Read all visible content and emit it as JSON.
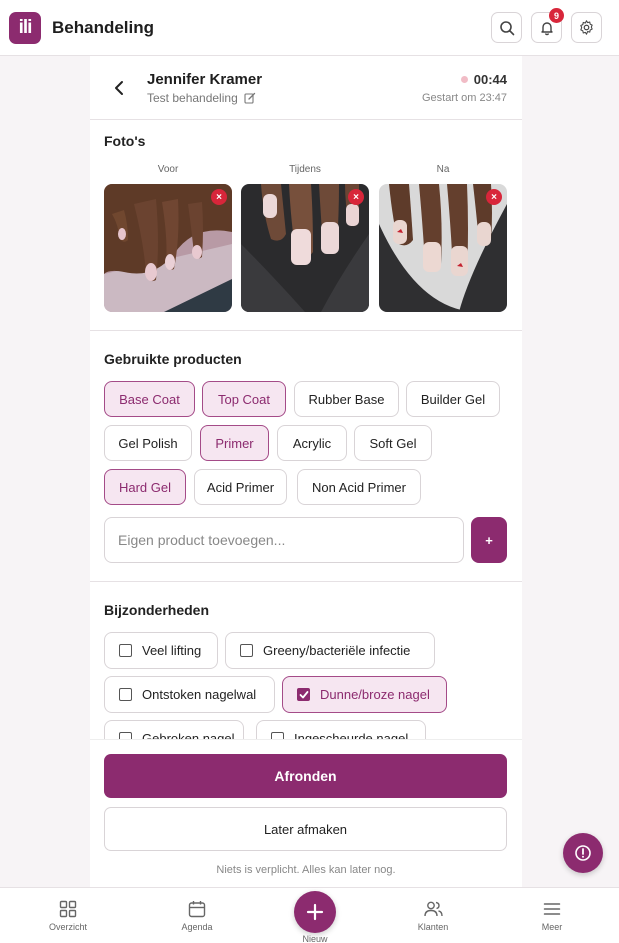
{
  "app": {
    "logo_text": "ili",
    "title": "Behandeling",
    "notification_count": "9",
    "accent": "#8c2b6f"
  },
  "header": {
    "client_name": "Jennifer Kramer",
    "treatment_name": "Test behandeling",
    "timer": "00:44",
    "started": "Gestart om 23:47"
  },
  "photos": {
    "title": "Foto's",
    "items": [
      {
        "label": "Voor"
      },
      {
        "label": "Tijdens"
      },
      {
        "label": "Na"
      }
    ],
    "remove_label": "×"
  },
  "products": {
    "title": "Gebruikte producten",
    "chips": [
      {
        "label": "Base Coat",
        "selected": true
      },
      {
        "label": "Top Coat",
        "selected": true
      },
      {
        "label": "Rubber Base",
        "selected": false
      },
      {
        "label": "Builder Gel",
        "selected": false
      },
      {
        "label": "Gel Polish",
        "selected": false
      },
      {
        "label": "Primer",
        "selected": true
      },
      {
        "label": "Acrylic",
        "selected": false
      },
      {
        "label": "Soft Gel",
        "selected": false
      },
      {
        "label": "Hard Gel",
        "selected": true
      },
      {
        "label": "Acid Primer",
        "selected": false
      },
      {
        "label": "Non Acid Primer",
        "selected": false
      }
    ],
    "custom_placeholder": "Eigen product toevoegen...",
    "add_label": "+"
  },
  "details": {
    "title": "Bijzonderheden",
    "items": [
      {
        "label": "Veel lifting",
        "checked": false
      },
      {
        "label": "Greeny/bacteriële infectie",
        "checked": false
      },
      {
        "label": "Ontstoken nagelwal",
        "checked": false
      },
      {
        "label": "Dunne/broze nagel",
        "checked": true
      },
      {
        "label": "Gebroken nagel",
        "checked": false
      },
      {
        "label": "Ingescheurde nagel",
        "checked": false
      }
    ]
  },
  "footer": {
    "finish": "Afronden",
    "later": "Later afmaken",
    "hint": "Niets is verplicht. Alles kan later nog."
  },
  "nav": {
    "items": [
      {
        "label": "Overzicht",
        "icon": "grid-icon"
      },
      {
        "label": "Agenda",
        "icon": "calendar-icon"
      },
      {
        "label": "Nieuw",
        "icon": "plus-icon"
      },
      {
        "label": "Klanten",
        "icon": "users-icon"
      },
      {
        "label": "Meer",
        "icon": "menu-icon"
      }
    ]
  }
}
